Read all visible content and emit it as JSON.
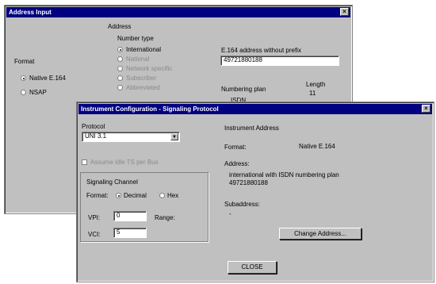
{
  "address_window": {
    "title": "Address Input",
    "address_heading": "Address",
    "number_type_label": "Number type",
    "number_types": [
      "International",
      "National",
      "Network specific",
      "Subscriber",
      "Abbreviated"
    ],
    "format_label": "Format",
    "format_options": [
      "Native E.164",
      "NSAP"
    ],
    "e164_label": "E.164 address without prefix",
    "e164_value": "49721880188",
    "numbering_plan_label": "Numbering plan",
    "numbering_plan_value": "ISDN",
    "length_label": "Length",
    "length_value": "11"
  },
  "config_window": {
    "title": "Instrument Configuration - Signaling Protocol",
    "protocol_label": "Protocol",
    "protocol_value": "UNI 3.1",
    "checkbox_label": "Assume idle TS per Bus",
    "signaling_channel_label": "Signaling Channel",
    "format_label": "Format:",
    "format_options": [
      "Decimal",
      "Hex"
    ],
    "vpi_label": "VPI:",
    "vpi_value": "0",
    "vci_label": "VCI:",
    "vci_value": "5",
    "range_label": "Range:",
    "instrument_address_label": "Instrument Address",
    "ia_format_label": "Format:",
    "ia_format_value": "Native E.164",
    "ia_address_label": "Address:",
    "ia_address_line1": "international with ISDN numbering plan",
    "ia_address_line2": "49721880188",
    "subaddress_label": "Subaddress:",
    "subaddress_value": "-",
    "change_address_button": "Change Address...",
    "close_button": "CLOSE"
  }
}
